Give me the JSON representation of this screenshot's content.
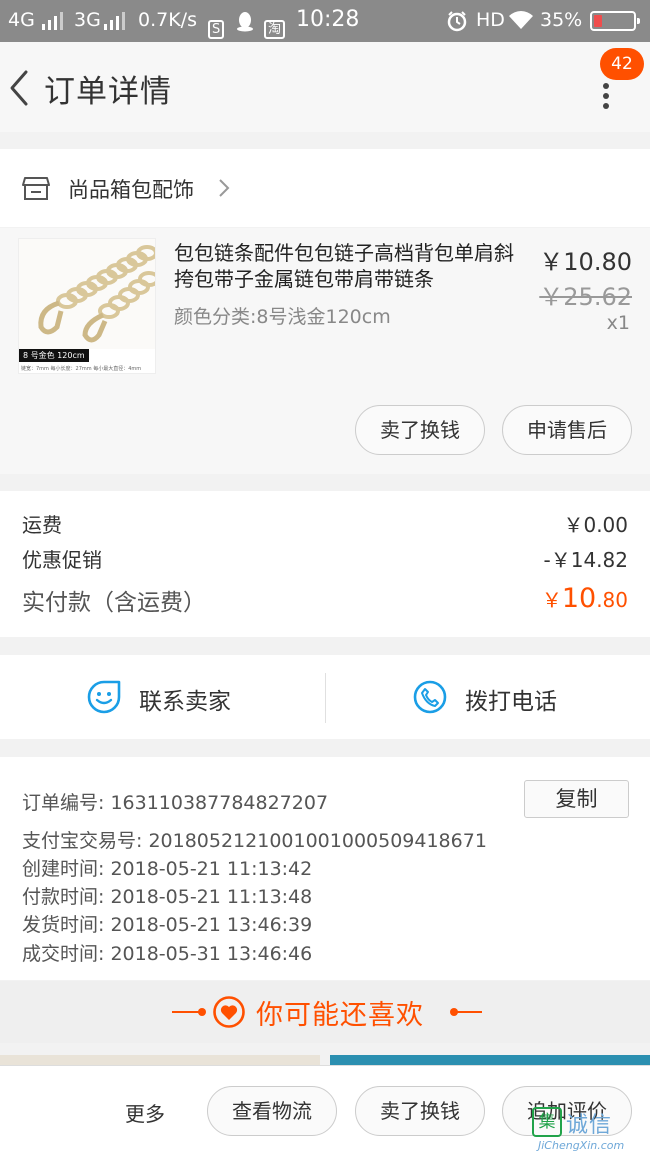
{
  "status_bar": {
    "network_4g": "4G",
    "network_3g": "3G",
    "speed": "0.7K/s",
    "s_badge": "S",
    "tao_badge": "淘",
    "time": "10:28",
    "hd": "HD",
    "battery": "35%"
  },
  "header": {
    "title": "订单详情",
    "badge_count": "42"
  },
  "shop": {
    "name": "尚品箱包配饰"
  },
  "product": {
    "title": "包包链条配件包包链子高档背包单肩斜挎包带子金属链包带肩带链条",
    "spec": "颜色分类:8号浅金120cm",
    "price": "￥10.80",
    "original_price": "￥25.62",
    "quantity": "x1",
    "image_caption": "8 号金色 120cm",
    "image_fine_print": "链宽：7mm   每小长度：27mm   每小最大直径：4mm",
    "actions": [
      "卖了换钱",
      "申请售后"
    ]
  },
  "fees": {
    "shipping_label": "运费",
    "shipping_value": "￥0.00",
    "discount_label": "优惠促销",
    "discount_value": "-￥14.82",
    "total_label": "实付款（含运费）",
    "total_currency": "￥",
    "total_int": "10",
    "total_dec": ".80"
  },
  "contact": {
    "seller_label": "联系卖家",
    "phone_label": "拨打电话"
  },
  "order_info": {
    "order_no": "订单编号:   163110387784827207",
    "copy_label": "复制",
    "alipay_no": "支付宝交易号:   2018052121001001000509418671",
    "created": "创建时间:   2018-05-21 11:13:42",
    "paid": "付款时间:   2018-05-21 11:13:48",
    "shipped": "发货时间:   2018-05-21 13:46:39",
    "completed": "成交时间:   2018-05-31 13:46:46"
  },
  "recommend": {
    "title": "你可能还喜欢"
  },
  "bottom_bar": {
    "more_label": "更多",
    "buttons": [
      "查看物流",
      "卖了换钱",
      "追加评价"
    ]
  },
  "watermark": {
    "mark": "集",
    "cn": "诚信",
    "en": "JiChengXin.com"
  },
  "colors": {
    "accent": "#ff5000",
    "icon_blue": "#1a9ee6"
  }
}
